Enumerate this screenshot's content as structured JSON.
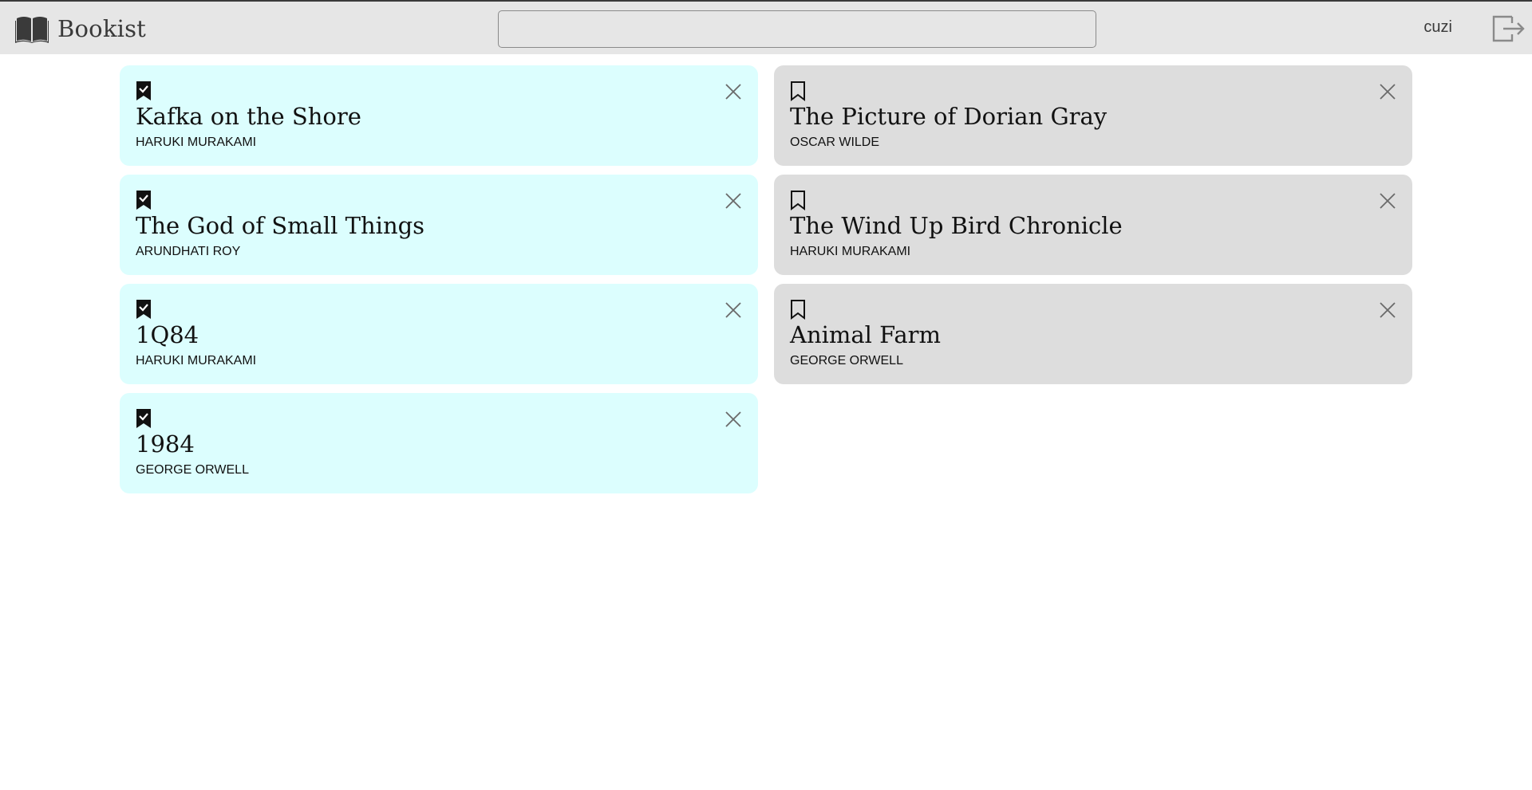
{
  "app": {
    "name": "Bookist",
    "logo_icon": "open-book-icon"
  },
  "header": {
    "search_value": "",
    "search_placeholder": "",
    "username": "cuzi",
    "logout_icon": "logout-icon"
  },
  "colors": {
    "read_card": "#dcfefe",
    "unread_card": "#dddddd",
    "header_bg": "#e6e6e6"
  },
  "books_left": [
    {
      "title": "Kafka on the Shore",
      "author": "HARUKI MURAKAMI",
      "status": "read",
      "bookmark_icon": "bookmark-check-icon"
    },
    {
      "title": "The God of Small Things",
      "author": "ARUNDHATI ROY",
      "status": "read",
      "bookmark_icon": "bookmark-check-icon"
    },
    {
      "title": "1Q84",
      "author": "HARUKI MURAKAMI",
      "status": "read",
      "bookmark_icon": "bookmark-check-icon"
    },
    {
      "title": "1984",
      "author": "GEORGE ORWELL",
      "status": "read",
      "bookmark_icon": "bookmark-check-icon"
    }
  ],
  "books_right": [
    {
      "title": "The Picture of Dorian Gray",
      "author": "OSCAR WILDE",
      "status": "unread",
      "bookmark_icon": "bookmark-outline-icon"
    },
    {
      "title": "The Wind Up Bird Chronicle",
      "author": "HARUKI MURAKAMI",
      "status": "unread",
      "bookmark_icon": "bookmark-outline-icon"
    },
    {
      "title": "Animal Farm",
      "author": "GEORGE ORWELL",
      "status": "unread",
      "bookmark_icon": "bookmark-outline-icon"
    }
  ]
}
